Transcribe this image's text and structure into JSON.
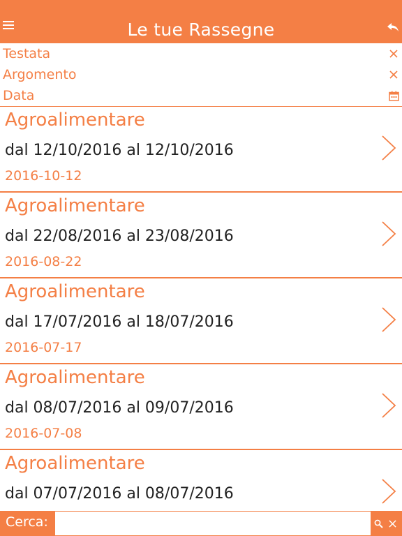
{
  "colors": {
    "accent": "#f47f45",
    "text": "#222222",
    "background": "#ffffff"
  },
  "header": {
    "title": "Le tue Rassegne",
    "menu_icon": "hamburger-menu-icon",
    "back_icon": "reply-arrow-icon"
  },
  "filters": [
    {
      "label": "Testata",
      "icon": "close-icon"
    },
    {
      "label": "Argomento",
      "icon": "close-icon"
    },
    {
      "label": "Data",
      "icon": "calendar-icon"
    }
  ],
  "items": [
    {
      "title": "Agroalimentare",
      "range": "dal 12/10/2016 al 12/10/2016",
      "date": "2016-10-12"
    },
    {
      "title": "Agroalimentare",
      "range": "dal 22/08/2016 al 23/08/2016",
      "date": "2016-08-22"
    },
    {
      "title": "Agroalimentare",
      "range": "dal 17/07/2016 al 18/07/2016",
      "date": "2016-07-17"
    },
    {
      "title": "Agroalimentare",
      "range": "dal 08/07/2016 al 09/07/2016",
      "date": "2016-07-08"
    },
    {
      "title": "Agroalimentare",
      "range": "dal 07/07/2016 al 08/07/2016",
      "date": ""
    }
  ],
  "search": {
    "label": "Cerca:",
    "value": "",
    "search_icon": "search-icon",
    "clear_icon": "close-icon"
  }
}
